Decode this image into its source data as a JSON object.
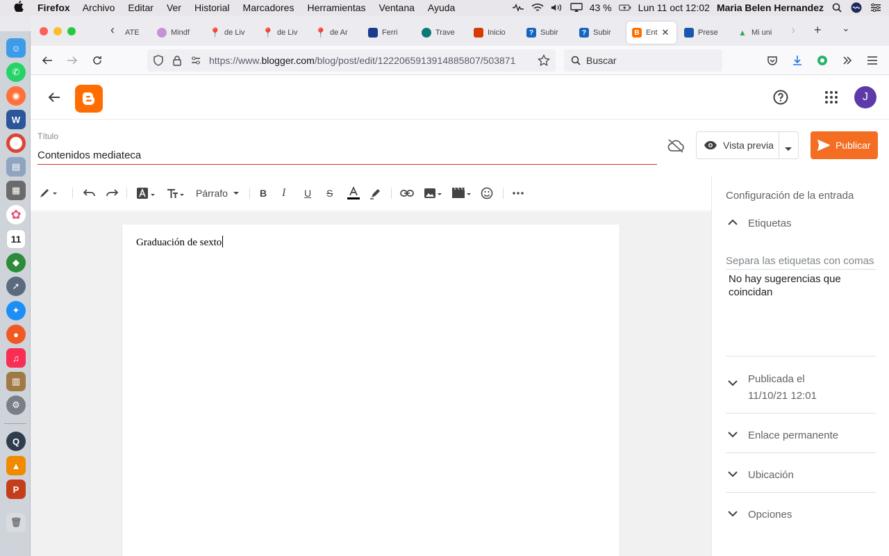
{
  "menubar": {
    "app": "Firefox",
    "items": [
      "Archivo",
      "Editar",
      "Ver",
      "Historial",
      "Marcadores",
      "Herramientas",
      "Ventana",
      "Ayuda"
    ],
    "battery": "43 %",
    "datetime": "Lun 11 oct  12:02",
    "user": "Maria Belen Hernandez"
  },
  "tabs": [
    {
      "label": "ATE",
      "icon": "back-chevron",
      "color": "#777777"
    },
    {
      "label": "Mindf",
      "icon": "mind-icon",
      "color": "#c592d8"
    },
    {
      "label": "de Liv",
      "icon": "maps-pin-icon",
      "color": "#34a853"
    },
    {
      "label": "de Liv",
      "icon": "maps-pin-icon",
      "color": "#34a853"
    },
    {
      "label": "de Ar",
      "icon": "maps-pin-icon",
      "color": "#34a853"
    },
    {
      "label": "Ferri",
      "icon": "flag-icon",
      "color": "#1a3c8f"
    },
    {
      "label": "Trave",
      "icon": "boat-icon",
      "color": "#0b7a75"
    },
    {
      "label": "Inicio",
      "icon": "office-icon",
      "color": "#d83b01"
    },
    {
      "label": "Subir",
      "icon": "question-icon",
      "color": "#1565c0"
    },
    {
      "label": "Subir",
      "icon": "question-icon",
      "color": "#1565c0"
    },
    {
      "label": "Ent",
      "icon": "blogger-icon",
      "color": "#ff6d00"
    },
    {
      "label": "Prese",
      "icon": "slides-icon",
      "color": "#1a56b0"
    },
    {
      "label": "Mi uni",
      "icon": "drive-icon",
      "color": "#34a853"
    }
  ],
  "url": {
    "prefix": "https://www.",
    "domain": "blogger.com",
    "path": "/blog/post/edit/1222065913914885807/503871"
  },
  "search": {
    "placeholder": "Buscar"
  },
  "editor": {
    "title_label": "Título",
    "title_value": "Contenidos mediateca",
    "preview_label": "Vista previa",
    "publish_label": "Publicar",
    "paragraph_label": "Párrafo",
    "body_text": "Graduación de sexto"
  },
  "avatar_initial": "J",
  "sidebar": {
    "title": "Configuración de la entrada",
    "labels_section": "Etiquetas",
    "labels_placeholder": "Separa las etiquetas con comas",
    "no_suggestions": "No hay sugerencias que coincidan",
    "published_label": "Publicada el",
    "published_date": "11/10/21 12:01",
    "permalink": "Enlace permanente",
    "location": "Ubicación",
    "options": "Opciones"
  },
  "colors": {
    "publish": "#f36e22",
    "blogger": "#ff6d00",
    "avatar": "#5c3aa8",
    "title_underline": "#d93025"
  }
}
